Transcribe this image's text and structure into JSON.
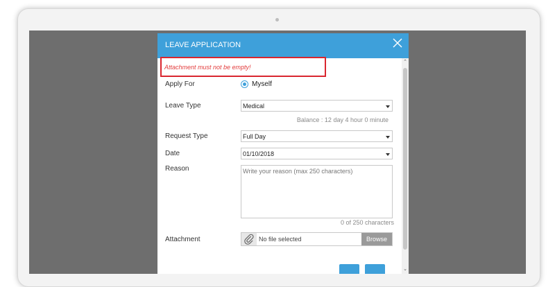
{
  "modal": {
    "title": "LEAVE APPLICATION",
    "error": "Attachment must not be empty!",
    "apply_for": {
      "label": "Apply For",
      "selected": "Myself"
    },
    "leave_type": {
      "label": "Leave Type",
      "value": "Medical"
    },
    "balance": "Balance : 12 day 4 hour 0 minute",
    "request_type": {
      "label": "Request Type",
      "value": "Full Day"
    },
    "date": {
      "label": "Date",
      "value": "01/10/2018"
    },
    "reason": {
      "label": "Reason",
      "placeholder": "Write your reason (max 250 characters)",
      "counter": "0 of 250 characters"
    },
    "attachment": {
      "label": "Attachment",
      "file_text": "No file selected",
      "browse_label": "Browse"
    }
  },
  "colors": {
    "header": "#3ea0da",
    "error": "#d9262f"
  },
  "icons": {
    "close": "close-icon",
    "attachment": "paperclip-icon",
    "dropdown": "chevron-down-icon"
  }
}
